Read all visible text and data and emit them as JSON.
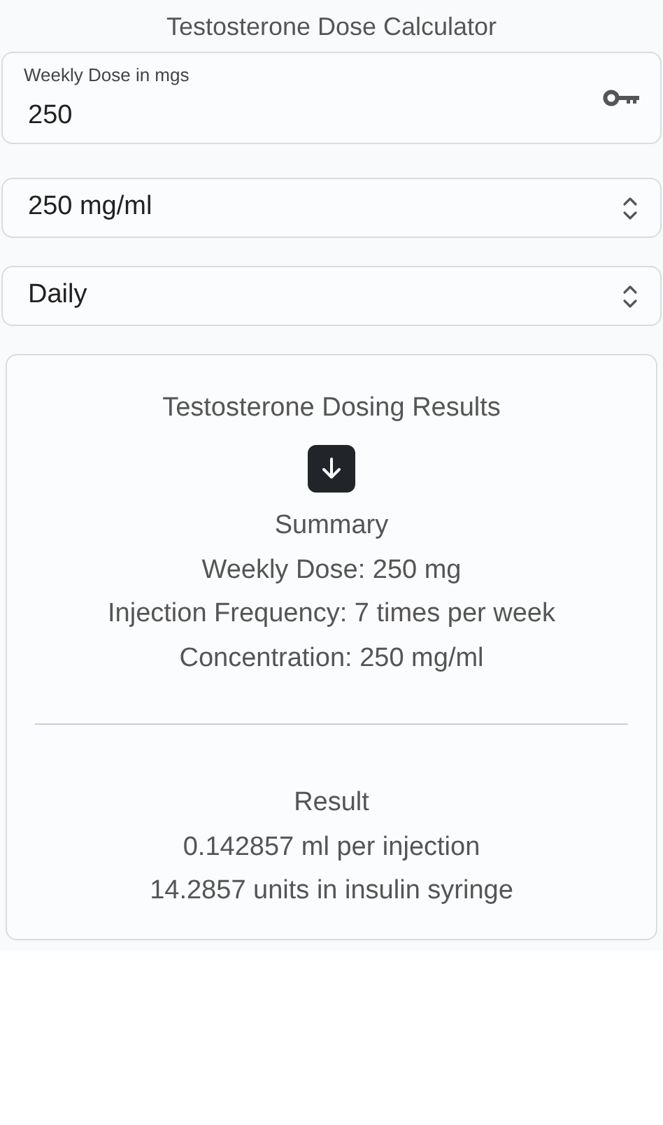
{
  "title": "Testosterone Dose Calculator",
  "dose_field": {
    "label": "Weekly Dose in mgs",
    "value": "250"
  },
  "selects": [
    {
      "value": "250 mg/ml"
    },
    {
      "value": "Daily"
    }
  ],
  "results": {
    "title": "Testosterone Dosing Results",
    "summary": {
      "heading": "Summary",
      "lines": [
        "Weekly Dose: 250 mg",
        "Injection Frequency: 7 times per week",
        "Concentration: 250 mg/ml"
      ]
    },
    "result": {
      "heading": "Result",
      "lines": [
        "0.142857 ml per injection",
        "14.2857 units in insulin syringe"
      ]
    }
  }
}
